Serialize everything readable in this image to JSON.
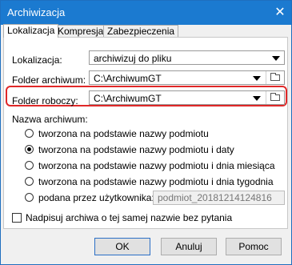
{
  "window": {
    "title": "Archiwizacja"
  },
  "tabs": [
    {
      "label": "Lokalizacja",
      "active": true
    },
    {
      "label": "Kompresja",
      "active": false
    },
    {
      "label": "Zabezpieczenia",
      "active": false
    }
  ],
  "location": {
    "lokalizacja_label": "Lokalizacja:",
    "lokalizacja_value": "archiwizuj do pliku",
    "archive_folder_label": "Folder archiwum:",
    "archive_folder_value": "C:\\ArchiwumGT",
    "working_folder_label": "Folder roboczy:",
    "working_folder_value": "C:\\ArchiwumGT"
  },
  "archive_name": {
    "label": "Nazwa archiwum:",
    "options": [
      {
        "label": "tworzona na podstawie nazwy podmiotu",
        "checked": false
      },
      {
        "label": "tworzona na podstawie nazwy podmiotu i daty",
        "checked": true
      },
      {
        "label": "tworzona na podstawie nazwy podmiotu i dnia miesiąca",
        "checked": false
      },
      {
        "label": "tworzona na podstawie nazwy podmiotu i dnia tygodnia",
        "checked": false
      },
      {
        "label": "podana przez użytkownika:",
        "checked": false
      }
    ],
    "custom_value": "podmiot_20181214124816"
  },
  "overwrite_label": "Nadpisuj archiwa o tej samej nazwie bez pytania",
  "buttons": {
    "ok": "OK",
    "cancel": "Anuluj",
    "help": "Pomoc"
  },
  "highlight_color": "#e02828",
  "titlebar_color": "#1b7ad0"
}
